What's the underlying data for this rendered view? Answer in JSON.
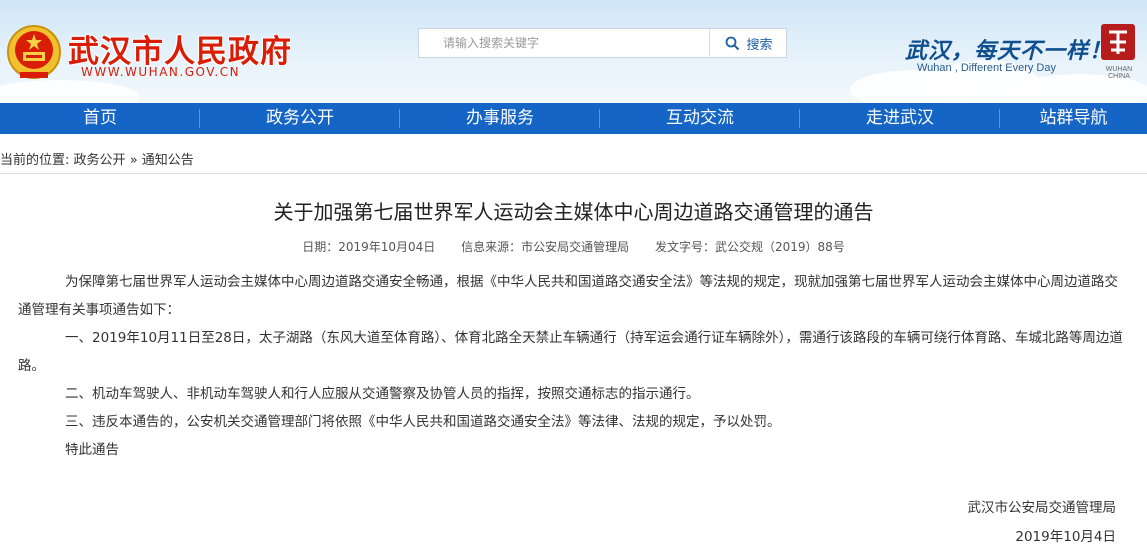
{
  "header": {
    "site_title": "武汉市人民政府",
    "site_url": "WWW.WUHAN.GOV.CN",
    "search_placeholder": "请输入搜索关键字",
    "search_button": "搜索",
    "slogan": "武汉，每天不一样！",
    "slogan_en": "Wuhan , Different Every Day",
    "seal_caption": "WUHAN CHINA",
    "brand_color": "#d81e06",
    "nav_color": "#1565c6"
  },
  "nav": {
    "items": [
      "首页",
      "政务公开",
      "办事服务",
      "互动交流",
      "走进武汉",
      "站群导航"
    ]
  },
  "breadcrumb": {
    "prefix": "当前的位置:",
    "level1": "政务公开",
    "separator": "»",
    "level2": "通知公告"
  },
  "article": {
    "title": "关于加强第七届世界军人运动会主媒体中心周边道路交通管理的通告",
    "date": "日期：2019年10月04日",
    "source": "信息来源：市公安局交通管理局",
    "doc_no": "发文字号：武公交规（2019）88号",
    "paragraphs": [
      "为保障第七届世界军人运动会主媒体中心周边道路交通安全畅通，根据《中华人民共和国道路交通安全法》等法规的规定，现就加强第七届世界军人运动会主媒体中心周边道路交通管理有关事项通告如下：",
      "一、2019年10月11日至28日，太子湖路（东风大道至体育路）、体育北路全天禁止车辆通行（持军运会通行证车辆除外），需通行该路段的车辆可绕行体育路、车城北路等周边道路。",
      "二、机动车驾驶人、非机动车驾驶人和行人应服从交通警察及协管人员的指挥，按照交通标志的指示通行。",
      "三、违反本通告的，公安机关交通管理部门将依照《中华人民共和国道路交通安全法》等法律、法规的规定，予以处罚。",
      "特此通告"
    ],
    "sign_org": "武汉市公安局交通管理局",
    "sign_date": "2019年10月4日"
  }
}
